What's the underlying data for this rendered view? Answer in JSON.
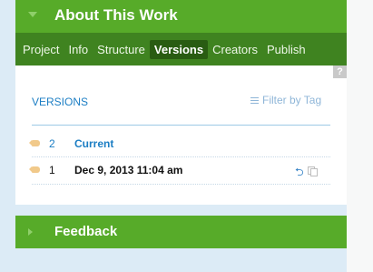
{
  "about": {
    "title": "About This Work"
  },
  "tabs": [
    {
      "label": "Project",
      "active": false
    },
    {
      "label": "Info",
      "active": false
    },
    {
      "label": "Structure",
      "active": false
    },
    {
      "label": "Versions",
      "active": true
    },
    {
      "label": "Creators",
      "active": false
    },
    {
      "label": "Publish",
      "active": false
    }
  ],
  "help": {
    "label": "?"
  },
  "versions": {
    "heading": "VERSIONS",
    "filter_label": "Filter by Tag",
    "rows": [
      {
        "number": "2",
        "name": "Current",
        "icon": "tag-icon"
      },
      {
        "number": "1",
        "name": "Dec 9, 2013 11:04 am",
        "icon": "tag-icon",
        "actions": [
          "restore-icon",
          "copy-icon"
        ]
      }
    ]
  },
  "restore_glyph": "⮌",
  "feedback": {
    "title": "Feedback"
  },
  "colors": {
    "header_green": "#57ab29",
    "tabbar_green": "#3f8320",
    "active_tab": "#295c12",
    "link_blue": "#1c7ec4",
    "background": "#dcebf6"
  }
}
